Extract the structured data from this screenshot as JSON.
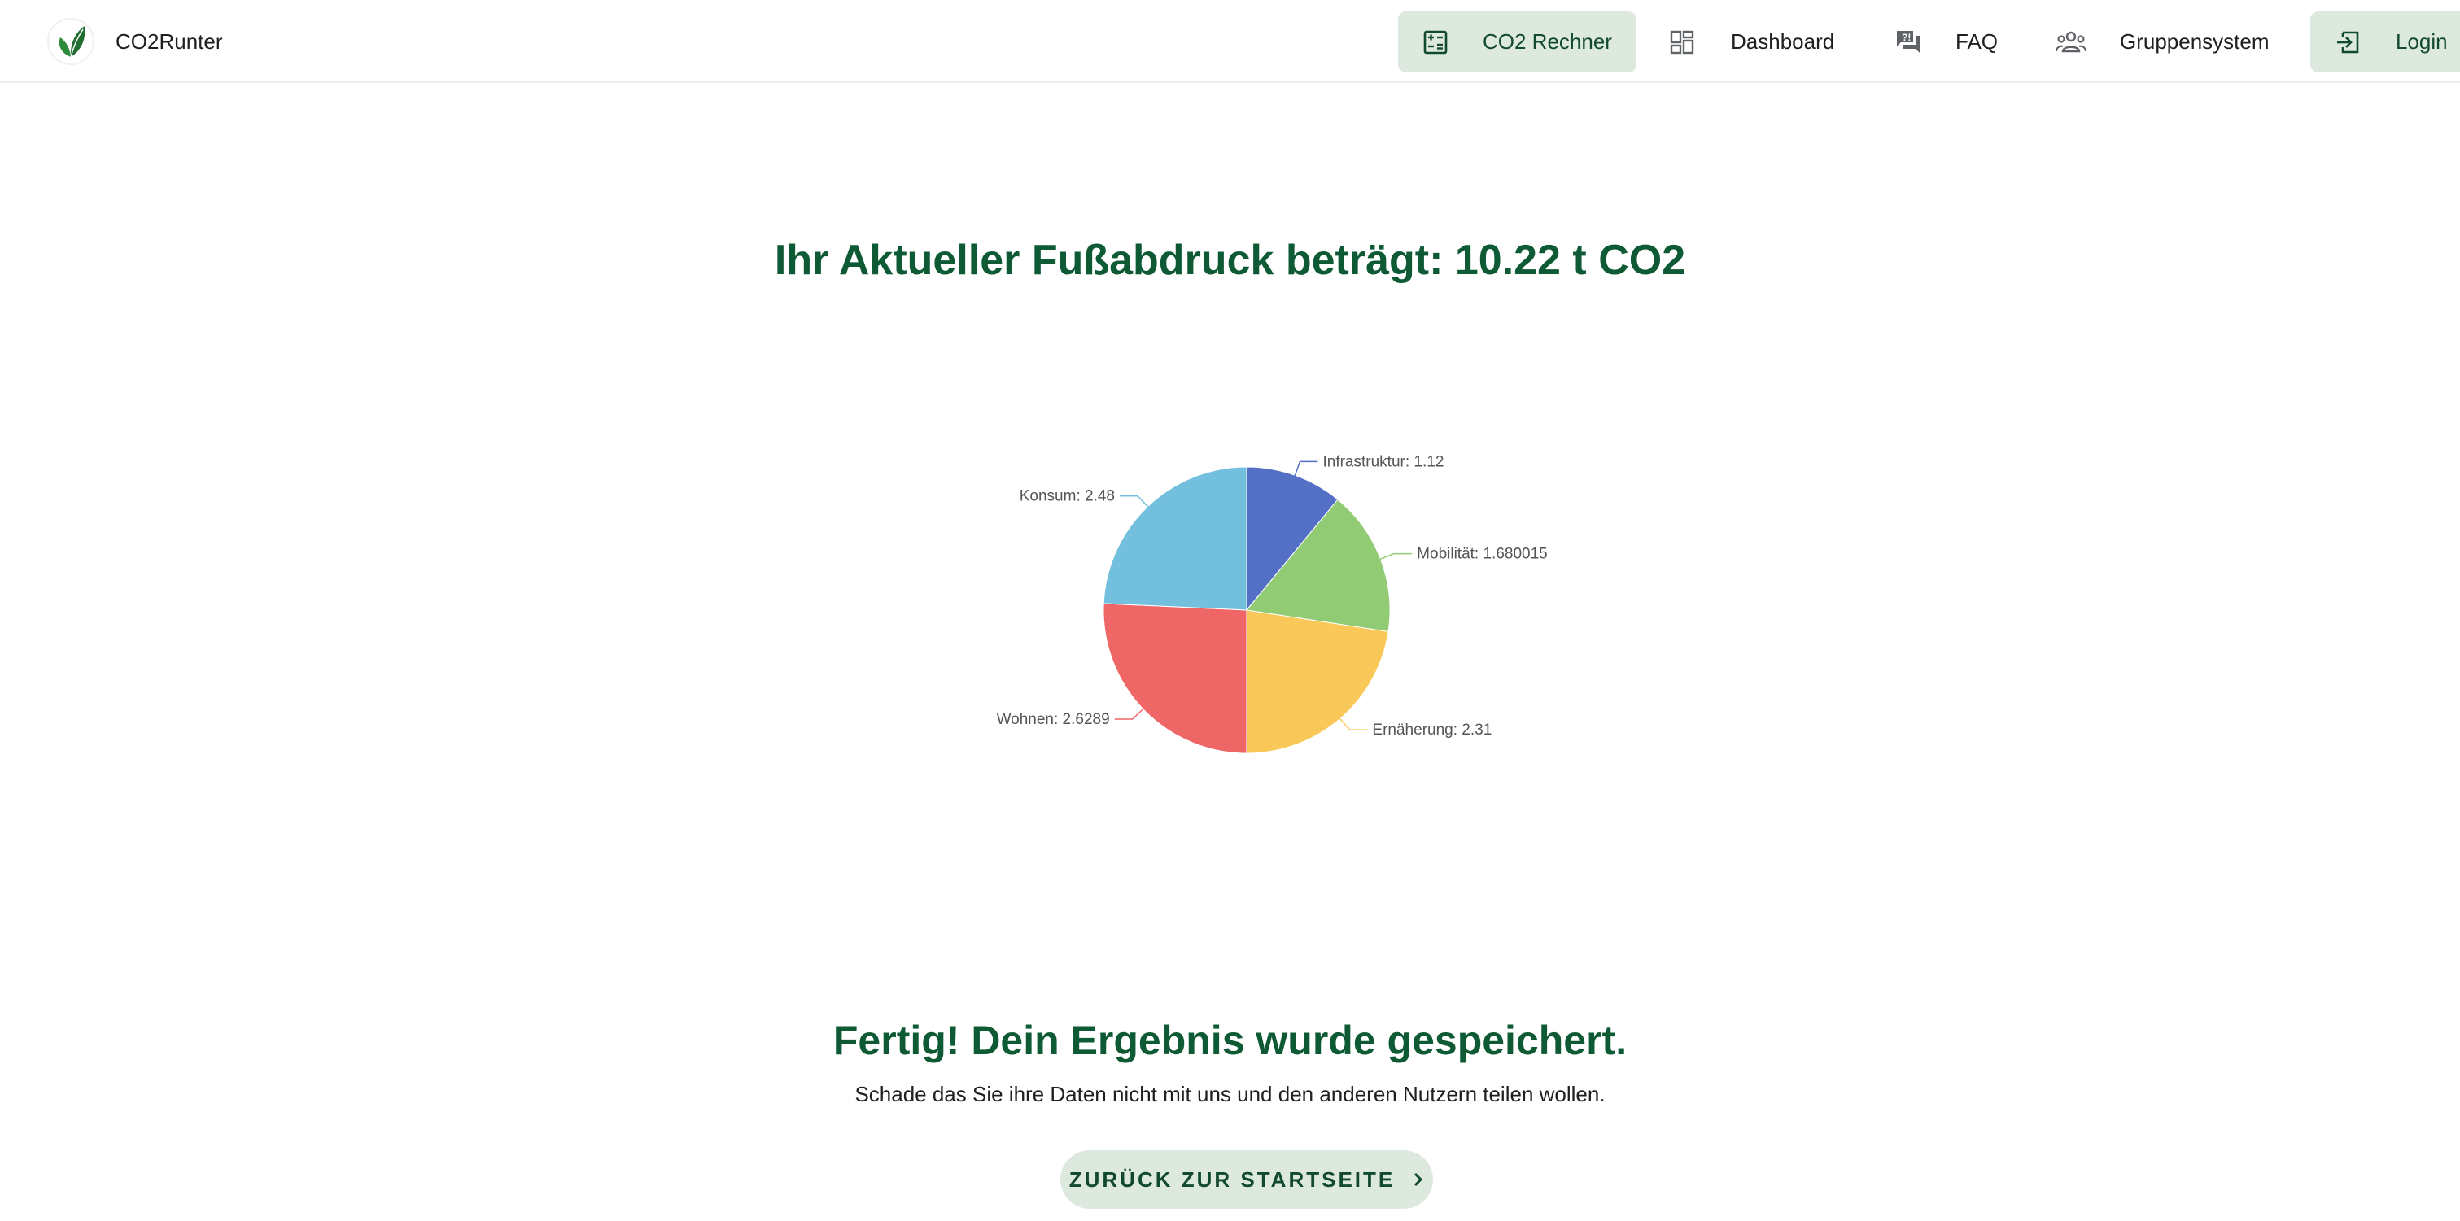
{
  "brand": {
    "name": "CO2Runter",
    "logo_icon": "leaf-icon",
    "accent": "#2e8b3c"
  },
  "nav": {
    "items": [
      {
        "id": "rechner",
        "label": "CO2 Rechner",
        "icon": "calculator-icon",
        "active": true
      },
      {
        "id": "dashboard",
        "label": "Dashboard",
        "icon": "dashboard-icon",
        "active": false
      },
      {
        "id": "faq",
        "label": "FAQ",
        "icon": "faq-icon",
        "active": false
      },
      {
        "id": "gruppen",
        "label": "Gruppensystem",
        "icon": "group-icon",
        "active": false
      },
      {
        "id": "login",
        "label": "Login",
        "icon": "login-icon",
        "active": true
      }
    ]
  },
  "main": {
    "headline": "Ihr Aktueller Fußabdruck beträgt: 10.22 t CO2",
    "done_title": "Fertig! Dein Ergebnis wurde gespeichert.",
    "done_text": "Schade das Sie ihre Daten nicht mit uns und den anderen Nutzern teilen wollen.",
    "back_button": "ZURÜCK ZUR STARTSEITE"
  },
  "colors": {
    "primary_text": "#0d5a35",
    "button_bg": "#dde8df"
  },
  "chart_data": {
    "type": "pie",
    "title": "",
    "slices": [
      {
        "label": "Infrastruktur: 1.12",
        "value": 1.12,
        "color": "#5470c6"
      },
      {
        "label": "Mobilität: 1.680015",
        "value": 1.680015,
        "color": "#91cc75"
      },
      {
        "label": "Ernäherung: 2.31",
        "value": 2.31,
        "color": "#fac858"
      },
      {
        "label": "Wohnen: 2.6289",
        "value": 2.6289,
        "color": "#ee6666"
      },
      {
        "label": "Konsum: 2.48",
        "value": 2.48,
        "color": "#73c0de"
      }
    ]
  }
}
